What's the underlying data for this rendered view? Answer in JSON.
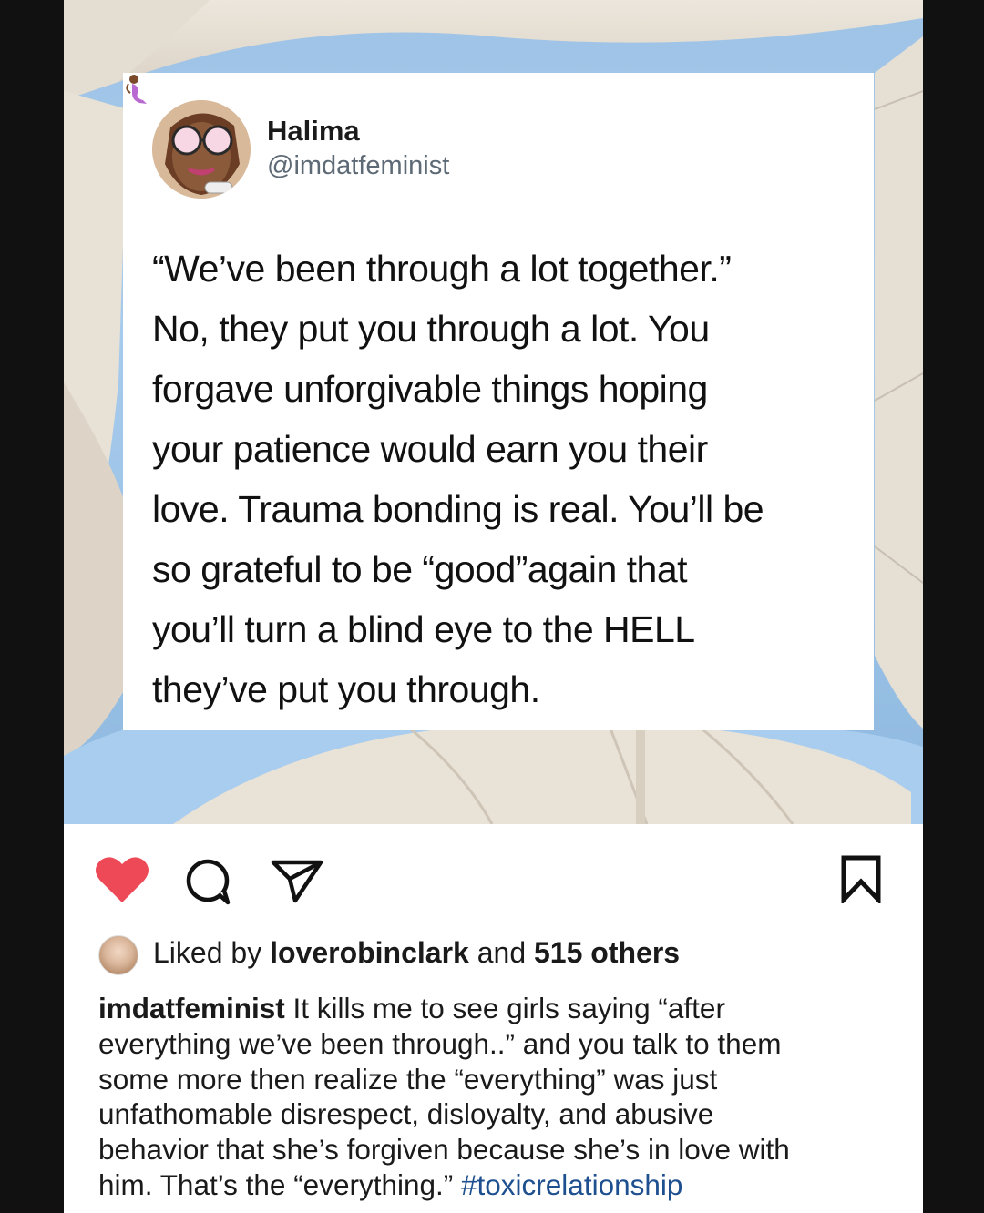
{
  "tweet": {
    "display_name": "Halima",
    "name_emoji": "mermaid-emoji",
    "handle": "@imdatfeminist",
    "text_lines": [
      "“We’ve been through a lot together.”",
      "No, they put you through a lot. You",
      "forgave unforgivable things hoping",
      "your patience would earn you their",
      "love. Trauma bonding is real. You’ll be",
      "so grateful to be “good”again that",
      "you’ll turn a blind eye to the HELL",
      "they’ve put you through."
    ]
  },
  "post": {
    "actions": {
      "like_icon": "heart-icon",
      "comment_icon": "comment-icon",
      "share_icon": "send-icon",
      "save_icon": "bookmark-icon",
      "liked": true,
      "like_color": "#ed4956"
    },
    "likes": {
      "prefix": "Liked by",
      "user": "loverobinclark",
      "connector": "and",
      "others": "515 others"
    },
    "caption": {
      "username": "imdatfeminist",
      "lines": [
        " It kills me to see girls saying “after",
        "everything we’ve been through..” and you talk to them",
        "some more then realize the “everything” was just",
        "unfathomable disrespect, disloyalty, and abusive",
        "behavior that she’s forgiven because she’s in love with",
        "him. That’s the “everything.” "
      ],
      "hashtag": "#toxicrelationship",
      "hashtag_color": "#1e4f8f"
    }
  }
}
